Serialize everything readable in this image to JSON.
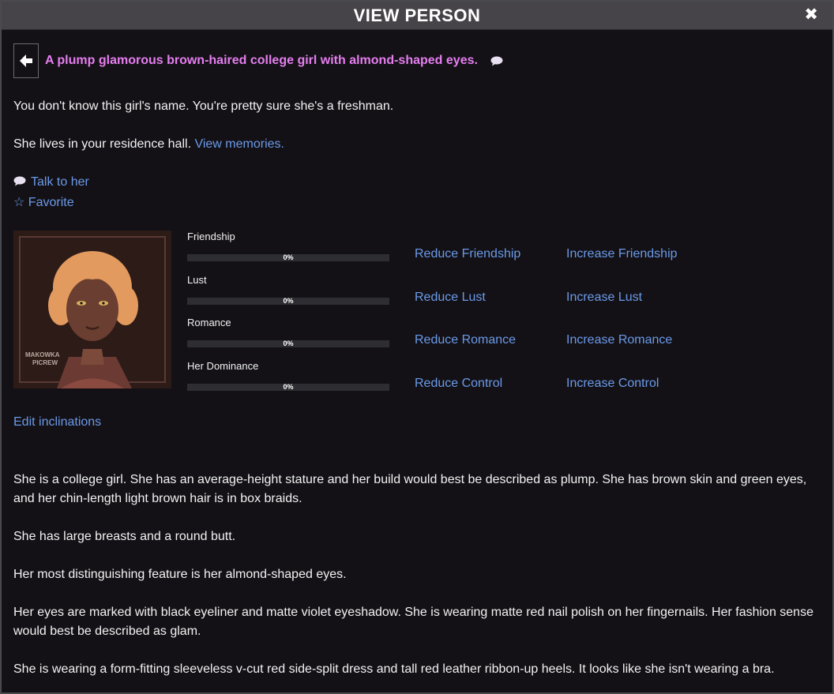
{
  "window": {
    "title": "VIEW PERSON",
    "close_glyph": "✖"
  },
  "person": {
    "title": "A plump glamorous brown-haired college girl with almond-shaped eyes.",
    "talk_icon": "speech-bubble-icon"
  },
  "info": {
    "name_line": "You don't know this girl's name. You're pretty sure she's a freshman.",
    "residence_text": "She lives in your residence hall.",
    "view_memories": "View memories."
  },
  "actions": {
    "talk_icon": "💬",
    "talk_label": "Talk to her",
    "favorite_icon": "☆",
    "favorite_label": "Favorite"
  },
  "portrait": {
    "watermark_line1": "MAKOWKA",
    "watermark_line2": "PICREW"
  },
  "stats": [
    {
      "label": "Friendship",
      "value": 0,
      "percent_text": "0%",
      "reduce": "Reduce Friendship",
      "increase": "Increase Friendship"
    },
    {
      "label": "Lust",
      "value": 0,
      "percent_text": "0%",
      "reduce": "Reduce Lust",
      "increase": "Increase Lust"
    },
    {
      "label": "Romance",
      "value": 0,
      "percent_text": "0%",
      "reduce": "Reduce Romance",
      "increase": "Increase Romance"
    },
    {
      "label": "Her Dominance",
      "value": 0,
      "percent_text": "0%",
      "reduce": "Reduce Control",
      "increase": "Increase Control"
    }
  ],
  "edit_inclinations": "Edit inclinations",
  "description": [
    "She is a college girl. She has an average-height stature and her build would best be described as plump. She has brown skin and green eyes, and her chin-length light brown hair is in box braids.",
    "She has large breasts and a round butt.",
    "Her most distinguishing feature is her almond-shaped eyes.",
    "Her eyes are marked with black eyeliner and matte violet eyeshadow. She is wearing matte red nail polish on her fingernails. Her fashion sense would best be described as glam.",
    "She is wearing a form-fitting sleeveless v-cut red side-split dress and tall red leather ribbon-up heels. It looks like she isn't wearing a bra."
  ],
  "colors": {
    "accent_link": "#6b9ae8",
    "title_pink": "#e67ef0",
    "background": "#131116"
  }
}
